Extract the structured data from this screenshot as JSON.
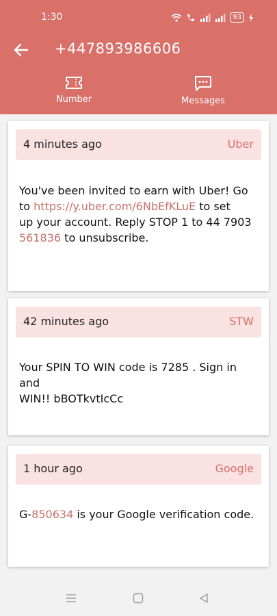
{
  "status_bar": {
    "time": "1:30",
    "battery": "93"
  },
  "header": {
    "title": "+447893986606"
  },
  "tabs": [
    {
      "label": "Number",
      "icon": "ticket-icon"
    },
    {
      "label": "Messages",
      "icon": "message-icon"
    }
  ],
  "messages": [
    {
      "time": "4 minutes ago",
      "sender": "Uber",
      "text_1": "You've been invited to earn with Uber! Go",
      "text_2_prefix": "to ",
      "link": "https://y.uber.com/6NbEfKLuE",
      "text_2_suffix": " to set",
      "text_3": "up your account. Reply STOP 1 to 44 7903",
      "code": "561836",
      "text_4_suffix": " to unsubscribe."
    },
    {
      "time": "42 minutes ago",
      "sender": "STW",
      "text_1": "Your SPIN TO WIN code is 7285 . Sign in and",
      "text_2": "WIN!! bBOTkvtIcCc"
    },
    {
      "time": "1 hour ago",
      "sender": "Google",
      "prefix": "G-",
      "code": "850634",
      "suffix": " is your Google verification code."
    }
  ],
  "colors": {
    "accent": "#d9706a",
    "card_header": "#f9e2e1",
    "link": "#c8716a"
  }
}
